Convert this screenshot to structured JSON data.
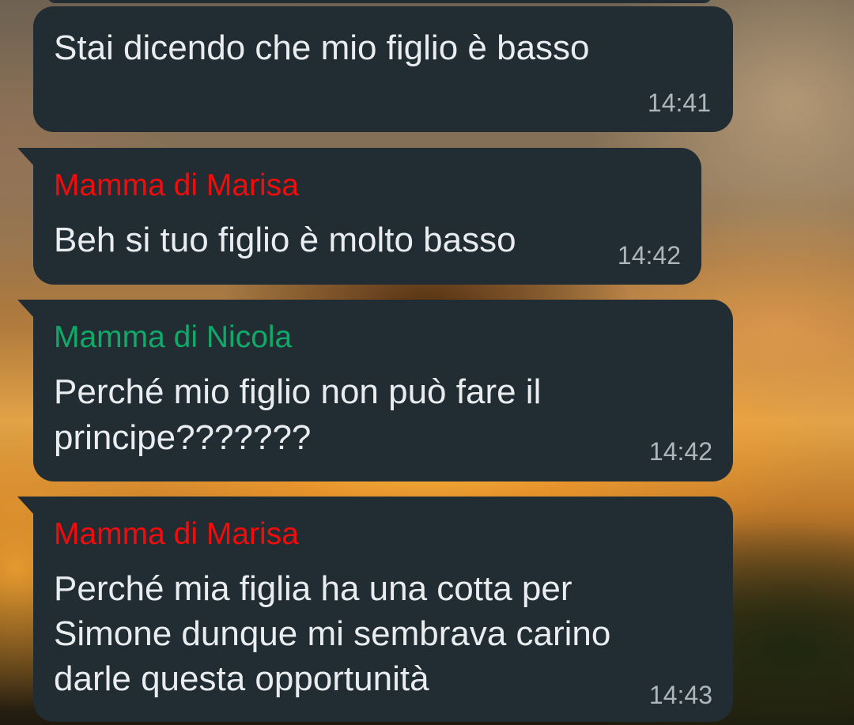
{
  "messages": [
    {
      "text_lines": [
        "Stai dicendo che mio figlio è basso"
      ],
      "time": "14:41"
    },
    {
      "sender": "Mamma di Marisa",
      "sender_color": "#f20c0c",
      "text_lines": [
        "Beh si tuo figlio è molto basso"
      ],
      "time": "14:42"
    },
    {
      "sender": "Mamma di Nicola",
      "sender_color": "#0fa968",
      "text_lines": [
        "Perché mio figlio non può fare il",
        "principe???????"
      ],
      "time": "14:42"
    },
    {
      "sender": "Mamma di Marisa",
      "sender_color": "#f20c0c",
      "text_lines": [
        "Perché mia figlia ha una cotta per",
        "Simone dunque mi sembrava carino",
        "darle questa opportunità"
      ],
      "time": "14:43"
    }
  ]
}
